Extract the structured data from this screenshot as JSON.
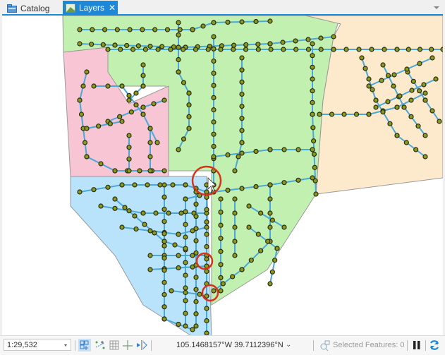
{
  "tabs": [
    {
      "label": "Catalog",
      "icon": "catalog-icon",
      "active": false
    },
    {
      "label": "Layers",
      "icon": "map-icon",
      "active": true,
      "closable": true
    }
  ],
  "tab_close_glyph": "✕",
  "colors": {
    "accent": "#1e88d8",
    "zone_green": "#c2f0b0",
    "zone_pink": "#f7c5d3",
    "zone_blue": "#b8e3fb",
    "zone_tan": "#fde9cc",
    "pipe": "#4aa8d8",
    "node_fill": "#8a9a1a",
    "node_stroke": "#2a2a10",
    "highlight_circle": "#d8331a"
  },
  "map": {
    "annotations": [
      "highlight-circle-1",
      "highlight-circle-2",
      "highlight-circle-3"
    ]
  },
  "statusbar": {
    "scale": "1:29,532",
    "coordinates": "105.1468157°W 39.7112396°N",
    "coords_dropdown": "⌄",
    "selected_features_label": "Selected Features: 0",
    "tools": [
      "snapping-icon",
      "constraints-icon",
      "grid-icon",
      "cross-icon",
      "correction-icon"
    ]
  }
}
